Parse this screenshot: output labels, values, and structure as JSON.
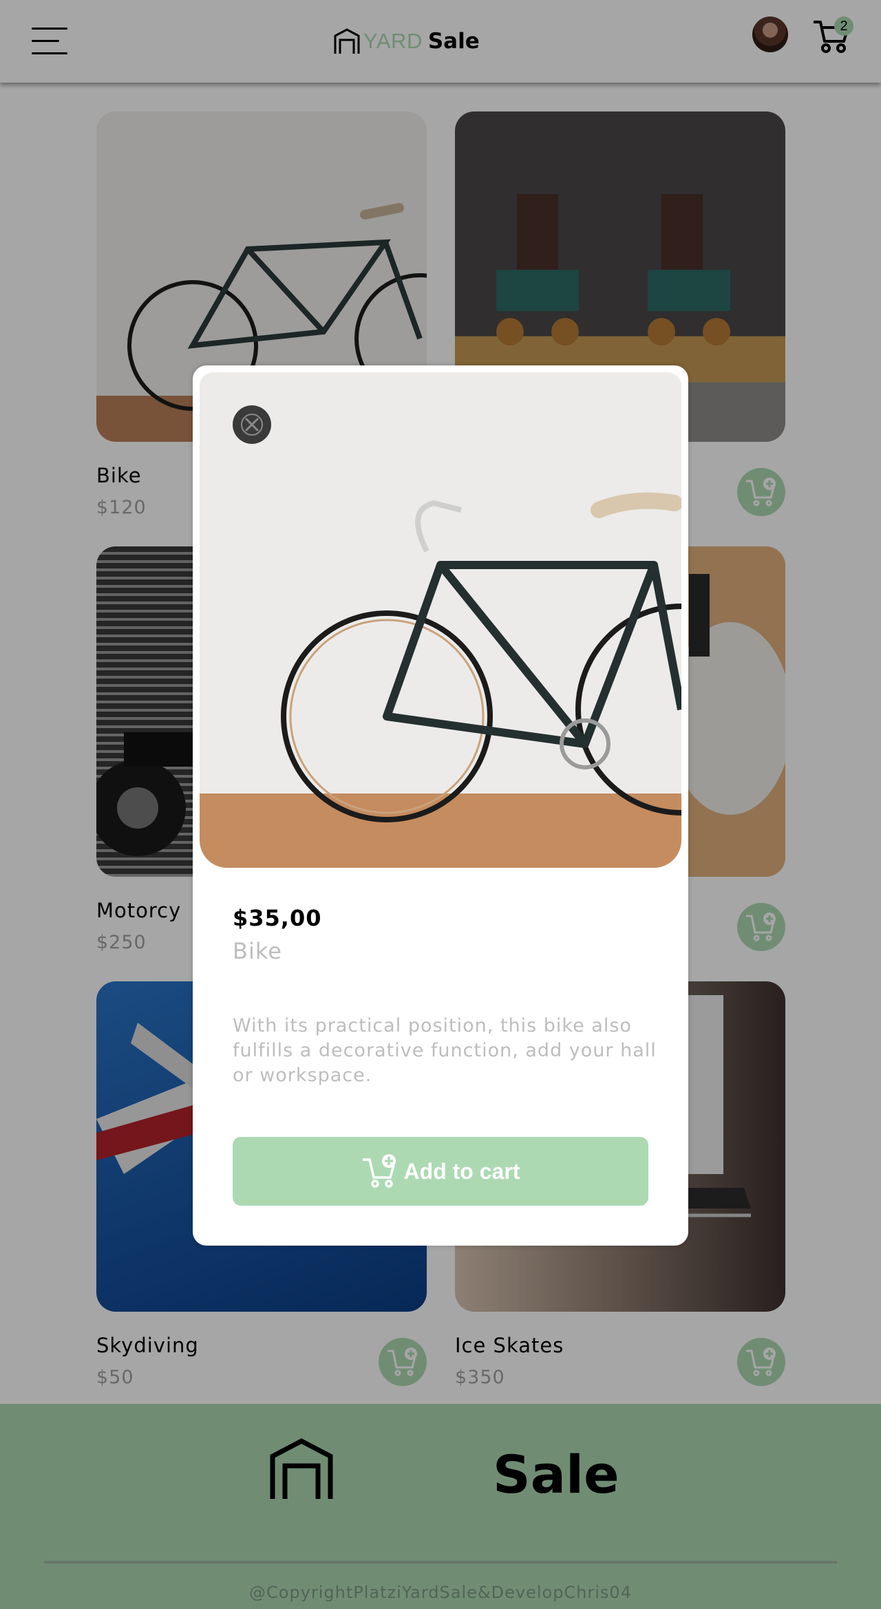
{
  "header": {
    "logo_yard": "YARD",
    "logo_sale": "Sale",
    "cart_count": "2",
    "icons": {
      "menu": "hamburger-icon",
      "cart": "shopping-cart-icon",
      "logo": "garage-icon"
    }
  },
  "products": [
    {
      "name": "Bike",
      "price": "$120"
    },
    {
      "name": "",
      "price": ""
    },
    {
      "name": "Motorcy",
      "price": "$250"
    },
    {
      "name": "",
      "price": ""
    },
    {
      "name": "Skydiving",
      "price": "$50"
    },
    {
      "name": "Ice Skates",
      "price": "$350"
    }
  ],
  "modal": {
    "price": "$35,00",
    "name": "Bike",
    "description": "With its practical position, this bike also fulfills a decorative function, add your hall or workspace.",
    "add_to_cart_label": "Add to cart"
  },
  "footer": {
    "sale": "Sale",
    "copyright": "@CopyrightPlatziYardSale&DevelopChris04"
  },
  "colors": {
    "accent": "#acd9b2",
    "muted_text": "#bdbdbd"
  }
}
